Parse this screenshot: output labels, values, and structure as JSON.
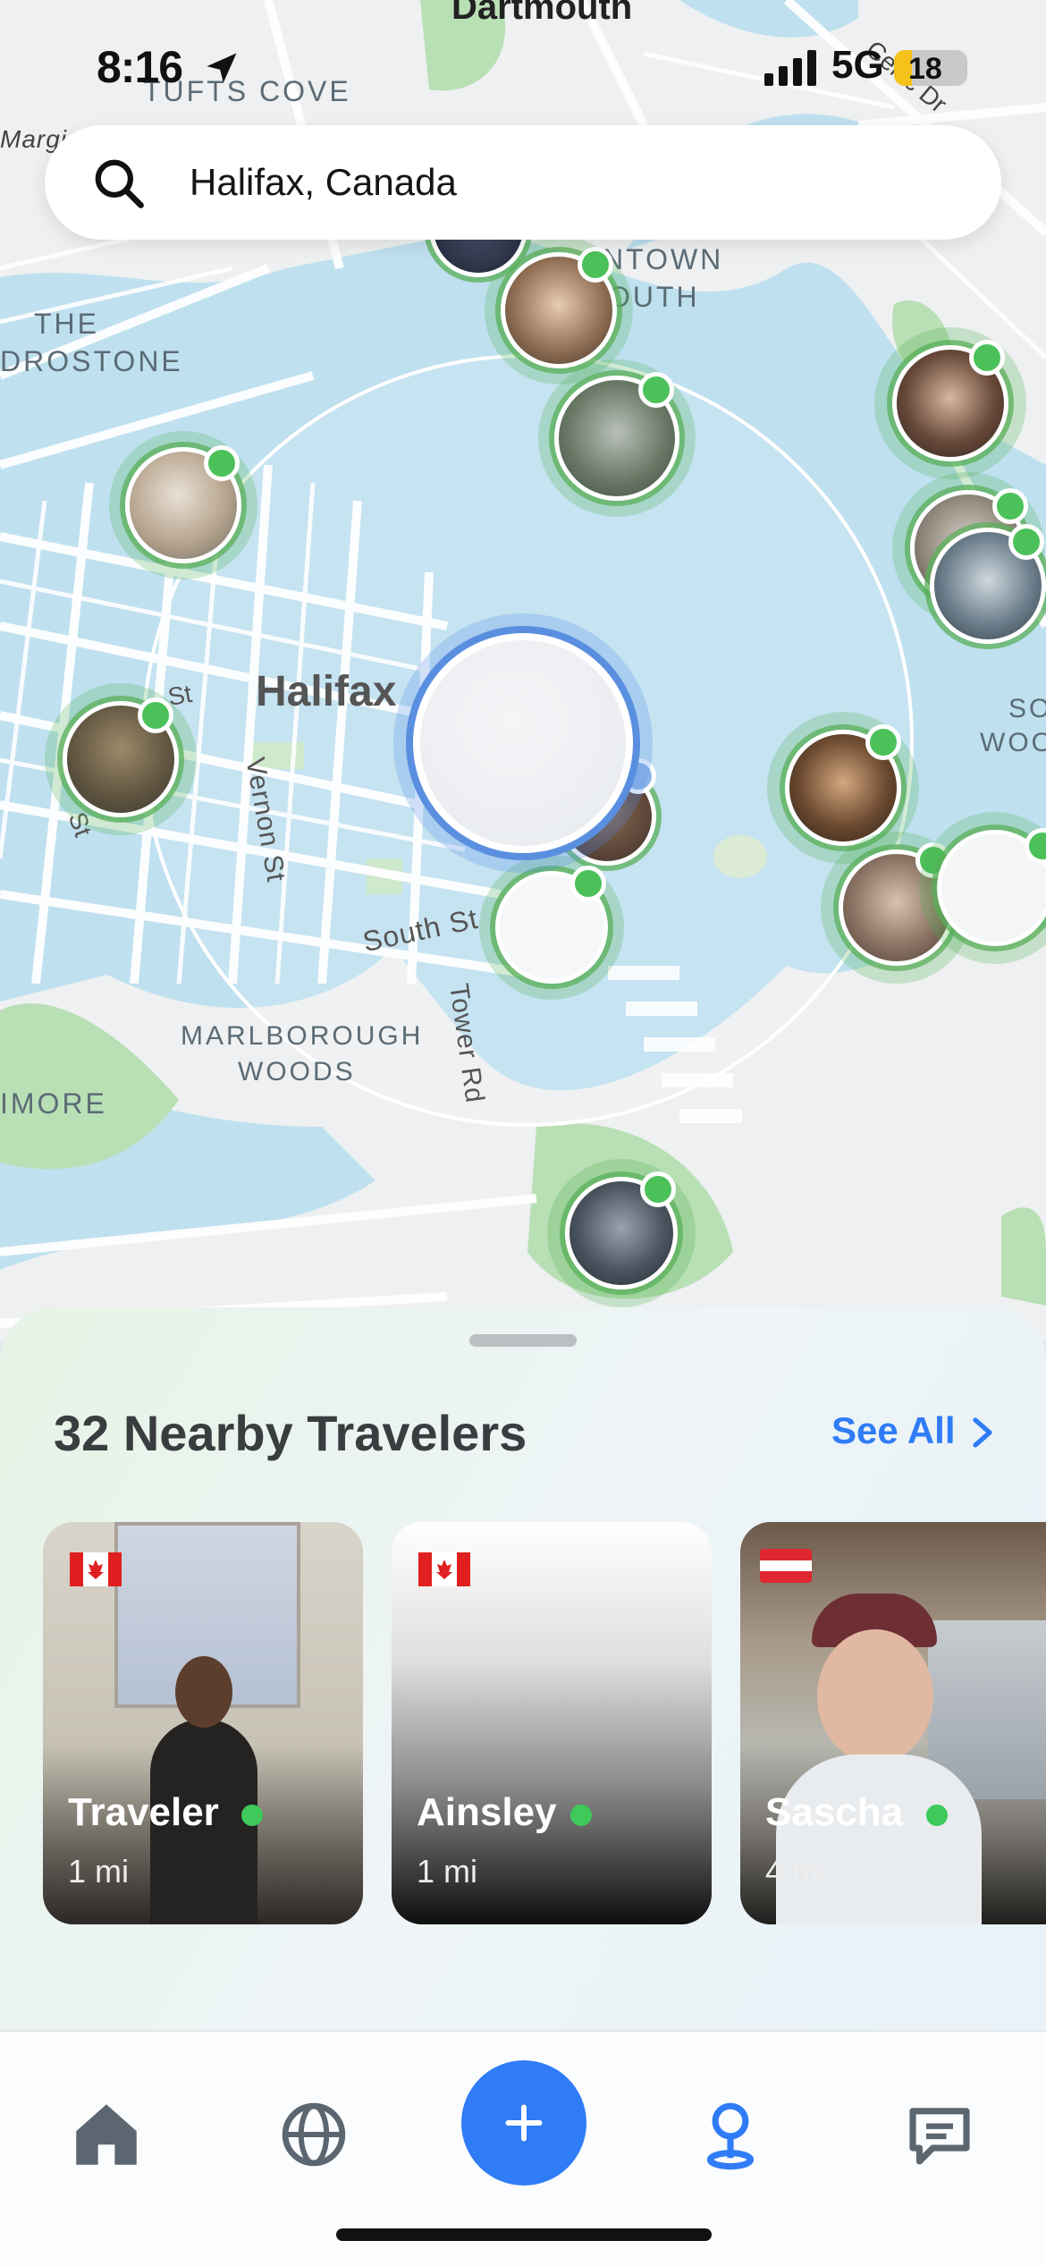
{
  "status_bar": {
    "time": "8:16",
    "network": "5G",
    "battery": "18"
  },
  "search": {
    "value": "Halifax, Canada"
  },
  "map": {
    "labels": {
      "dartmouth": "Dartmouth",
      "tufts_cove": "TUFTS COVE",
      "margin_left": "Margi",
      "the_drostone_1": "THE",
      "the_drostone_2": "DROSTONE",
      "downtown_1": "NTOWN",
      "downtown_2": "OUTH",
      "halifax": "Halifax",
      "vernon_st": "Vernon St",
      "south_st": "South St",
      "tower_rd": "Tower Rd",
      "marlborough_1": "MARLBOROUGH",
      "marlborough_2": "WOODS",
      "imore": "IMORE",
      "so_woo_1": "SO",
      "so_woo_2": "WOO",
      "st_left": "St",
      "st_left2": "St",
      "celtic_dr": "Celtic Dr"
    }
  },
  "sheet": {
    "title": "32 Nearby Travelers",
    "see_all": "See All",
    "cards": [
      {
        "name": "Traveler",
        "distance": "1 mi",
        "flag": "canada-flag"
      },
      {
        "name": "Ainsley",
        "distance": "1 mi",
        "flag": "canada-flag"
      },
      {
        "name": "Sascha",
        "distance": "4 mi",
        "flag": "austria-flag"
      }
    ]
  },
  "tabbar": {
    "items": [
      "home-icon",
      "globe-icon",
      "plus-icon",
      "map-pin-icon",
      "chat-icon"
    ],
    "active": "map-pin-icon",
    "accent": "#2f7cf6"
  },
  "colors": {
    "online": "#4cc15a",
    "accent": "#2f7cf6"
  }
}
